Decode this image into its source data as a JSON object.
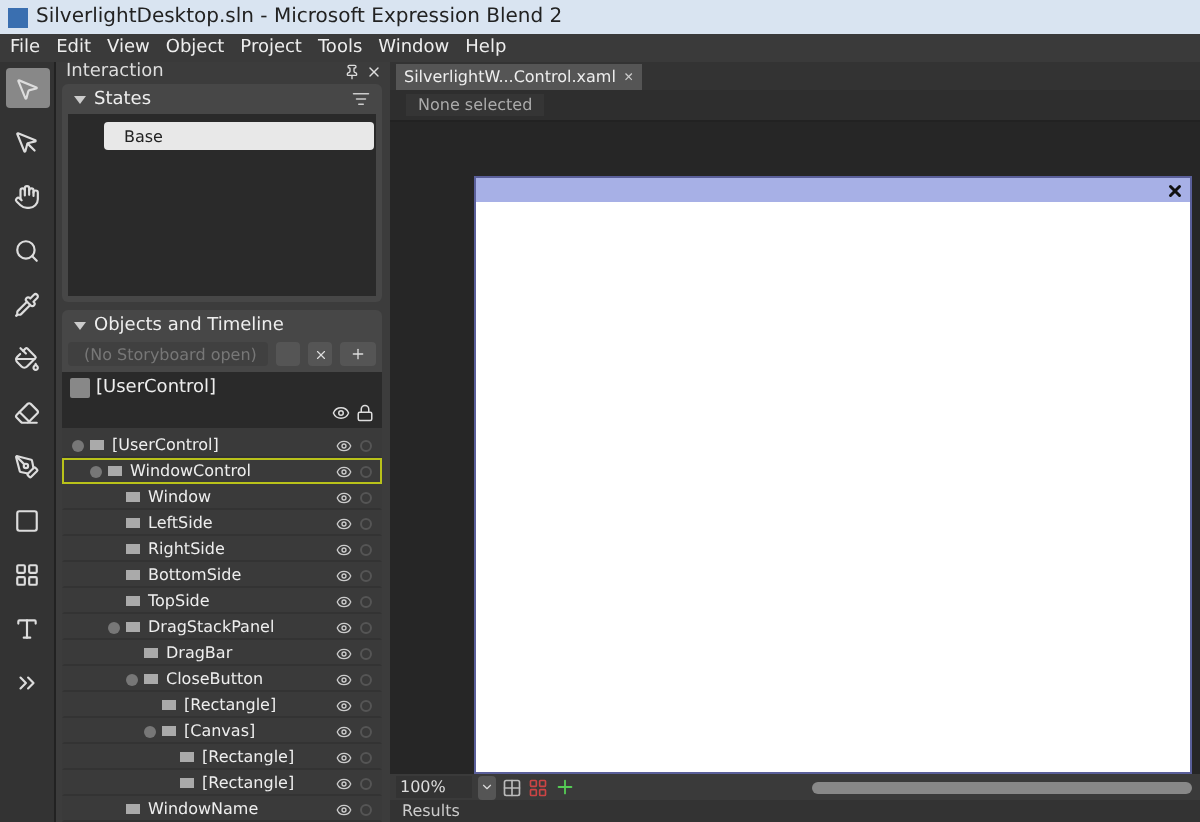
{
  "window": {
    "title": "SilverlightDesktop.sln - Microsoft Expression Blend 2"
  },
  "menu": [
    "File",
    "Edit",
    "View",
    "Object",
    "Project",
    "Tools",
    "Window",
    "Help"
  ],
  "interaction_panel": {
    "title": "Interaction"
  },
  "states": {
    "title": "States",
    "items": [
      {
        "label": "Base",
        "selected": true
      }
    ]
  },
  "objects": {
    "title": "Objects and Timeline",
    "storyboard": "(No Storyboard open)",
    "scope": "[UserControl]",
    "tree": [
      {
        "label": "[UserControl]",
        "selected": false,
        "children": [
          {
            "label": "WindowControl",
            "selected": true,
            "children": [
              {
                "label": "Window",
                "selected": false
              },
              {
                "label": "LeftSide",
                "selected": false
              },
              {
                "label": "RightSide",
                "selected": false
              },
              {
                "label": "BottomSide",
                "selected": false
              },
              {
                "label": "TopSide",
                "selected": false
              },
              {
                "label": "DragStackPanel",
                "selected": false,
                "children": [
                  {
                    "label": "DragBar",
                    "selected": false
                  },
                  {
                    "label": "CloseButton",
                    "selected": false,
                    "children": [
                      {
                        "label": "[Rectangle]",
                        "selected": false
                      },
                      {
                        "label": "[Canvas]",
                        "selected": false,
                        "children": [
                          {
                            "label": "[Rectangle]",
                            "selected": false
                          },
                          {
                            "label": "[Rectangle]",
                            "selected": false
                          }
                        ]
                      }
                    ]
                  }
                ]
              },
              {
                "label": "WindowName",
                "selected": false
              }
            ]
          }
        ]
      }
    ]
  },
  "document_tab": {
    "label": "SilverlightW...Control.xaml",
    "close": "×"
  },
  "breadcrumb": "None selected",
  "zoom": "100%",
  "results": "Results"
}
